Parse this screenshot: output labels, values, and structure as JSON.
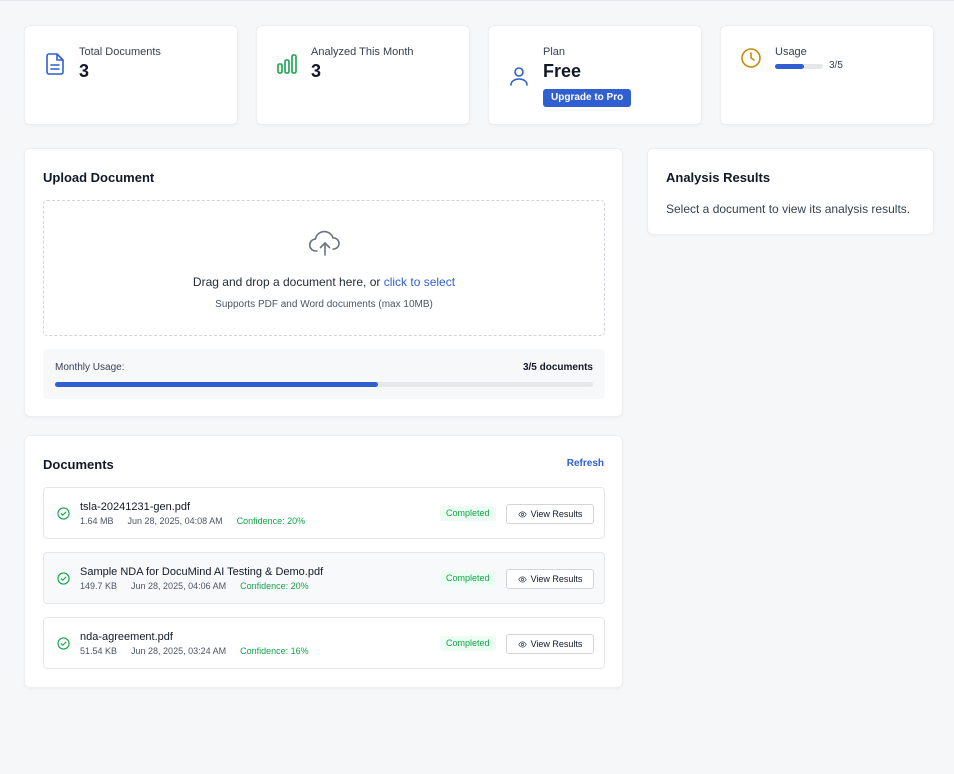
{
  "stats": {
    "total_documents": {
      "label": "Total Documents",
      "value": "3"
    },
    "analyzed_month": {
      "label": "Analyzed This Month",
      "value": "3"
    },
    "plan": {
      "label": "Plan",
      "value": "Free",
      "upgrade_label": "Upgrade to Pro"
    },
    "usage": {
      "label": "Usage",
      "value": "3/5",
      "fraction": 0.6
    }
  },
  "upload": {
    "title": "Upload Document",
    "drop_text": "Drag and drop a document here, or ",
    "select_link": "click to select",
    "supports_text": "Supports PDF and Word documents (max 10MB)",
    "monthly_label": "Monthly Usage:",
    "monthly_count": "3/5 documents",
    "monthly_fraction": 0.6
  },
  "documents": {
    "title": "Documents",
    "refresh_label": "Refresh",
    "items": [
      {
        "name": "tsla-20241231-gen.pdf",
        "size": "1.64 MB",
        "date": "Jun 28, 2025, 04:08 AM",
        "confidence": "Confidence: 20%",
        "status": "Completed",
        "action": "View Results"
      },
      {
        "name": "Sample NDA for DocuMind AI Testing & Demo.pdf",
        "size": "149.7 KB",
        "date": "Jun 28, 2025, 04:06 AM",
        "confidence": "Confidence: 20%",
        "status": "Completed",
        "action": "View Results"
      },
      {
        "name": "nda-agreement.pdf",
        "size": "51.54 KB",
        "date": "Jun 28, 2025, 03:24 AM",
        "confidence": "Confidence: 16%",
        "status": "Completed",
        "action": "View Results"
      }
    ]
  },
  "results": {
    "title": "Analysis Results",
    "empty_text": "Select a document to view its analysis results."
  },
  "colors": {
    "accent": "#2f5fd0",
    "success": "#16a34a",
    "usage_icon": "#ca8a04"
  },
  "icons": {
    "total_documents": "document-icon",
    "analyzed_month": "bar-chart-icon",
    "plan": "user-icon",
    "usage": "clock-icon",
    "upload": "cloud-upload-icon",
    "status": "check-circle-icon",
    "view": "eye-icon"
  }
}
